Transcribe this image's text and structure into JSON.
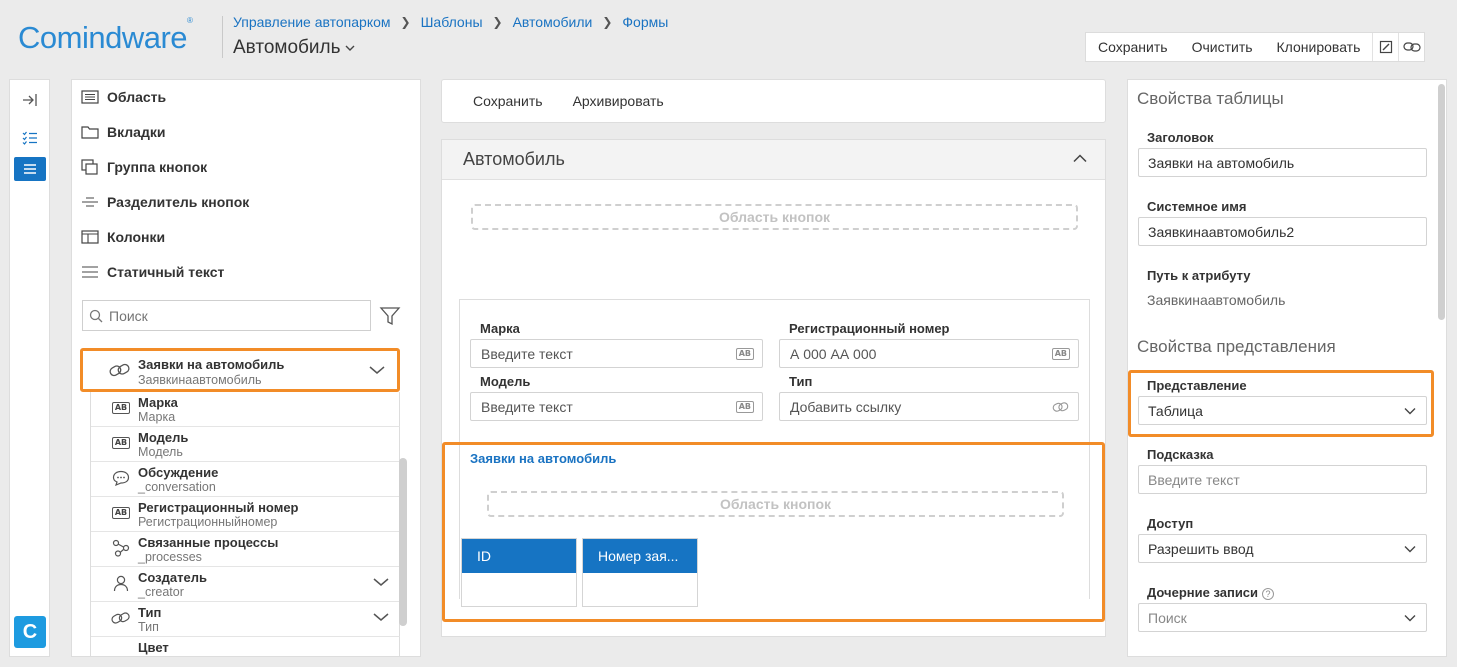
{
  "header": {
    "logo_text_1": "Comind",
    "logo_text_2": "ware",
    "logo_mark": "®",
    "breadcrumb": [
      "Управление автопарком",
      "Шаблоны",
      "Автомобили",
      "Формы"
    ],
    "title": "Автомобиль",
    "toolbar": {
      "save": "Сохранить",
      "clear": "Очистить",
      "clone": "Клонировать"
    }
  },
  "rail": {
    "logo_letter": "C"
  },
  "palette": {
    "items": [
      {
        "label": "Область",
        "icon": "region-icon"
      },
      {
        "label": "Вкладки",
        "icon": "tabs-folder-icon"
      },
      {
        "label": "Группа кнопок",
        "icon": "button-group-icon"
      },
      {
        "label": "Разделитель кнопок",
        "icon": "button-separator-icon"
      },
      {
        "label": "Колонки",
        "icon": "columns-icon"
      },
      {
        "label": "Статичный текст",
        "icon": "static-text-icon"
      }
    ],
    "search_placeholder": "Поиск",
    "tree_root": {
      "label": "Заявки на автомобиль",
      "sub": "Заявкинаавтомобиль"
    },
    "tree": [
      {
        "label": "Марка",
        "sub": "Марка",
        "icon": "text-ab-icon",
        "expand": false
      },
      {
        "label": "Модель",
        "sub": "Модель",
        "icon": "text-ab-icon",
        "expand": false
      },
      {
        "label": "Обсуждение",
        "sub": "_conversation",
        "icon": "comment-icon",
        "expand": false
      },
      {
        "label": "Регистрационный номер",
        "sub": "Регистрационныйномер",
        "icon": "text-ab-icon",
        "expand": false
      },
      {
        "label": "Связанные процессы",
        "sub": "_processes",
        "icon": "process-icon",
        "expand": false
      },
      {
        "label": "Создатель",
        "sub": "_creator",
        "icon": "user-icon",
        "expand": true
      },
      {
        "label": "Тип",
        "sub": "Тип",
        "icon": "link-icon",
        "expand": true
      },
      {
        "label": "Цвет",
        "sub": "",
        "icon": "text-ab-icon",
        "expand": false
      }
    ]
  },
  "center": {
    "actions": {
      "save": "Сохранить",
      "archive": "Архивировать"
    },
    "form_title": "Автомобиль",
    "button_area": "Область кнопок",
    "fields": {
      "brand_label": "Марка",
      "brand_placeholder": "Введите текст",
      "reg_label": "Регистрационный номер",
      "reg_placeholder": "А 000 АА 000",
      "model_label": "Модель",
      "model_placeholder": "Введите текст",
      "type_label": "Тип",
      "type_placeholder": "Добавить ссылку"
    },
    "table": {
      "title": "Заявки на автомобиль",
      "button_area": "Область кнопок",
      "columns": [
        "ID",
        "Номер зая..."
      ]
    }
  },
  "props": {
    "table_section": "Свойства таблицы",
    "heading_label": "Заголовок",
    "heading_value": "Заявки на автомобиль",
    "sysname_label": "Системное имя",
    "sysname_value": "Заявкинаавтомобиль2",
    "path_label": "Путь к атрибуту",
    "path_value": "Заявкинаавтомобиль",
    "view_section": "Свойства представления",
    "view_label": "Представление",
    "view_value": "Таблица",
    "hint_label": "Подсказка",
    "hint_placeholder": "Введите текст",
    "access_label": "Доступ",
    "access_value": "Разрешить ввод",
    "child_label": "Дочерние записи",
    "child_help": "?",
    "child_value": "Поиск"
  },
  "colors": {
    "accent": "#1674c3",
    "highlight": "#f28c28",
    "link": "#1a73c2"
  }
}
